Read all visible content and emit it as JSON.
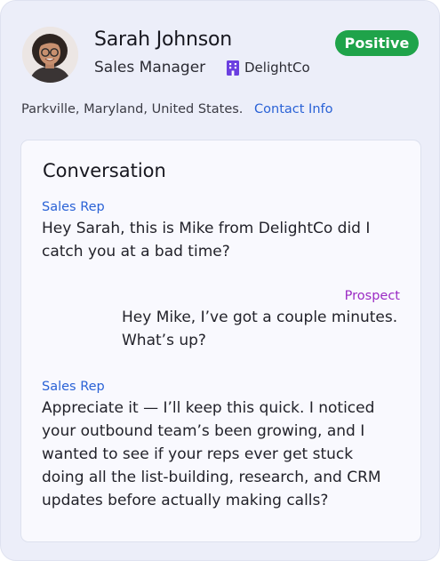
{
  "contact": {
    "name": "Sarah Johnson",
    "title": "Sales Manager",
    "company": "DelightCo",
    "company_icon": "building-icon",
    "sentiment": "Positive",
    "location": "Parkville, Maryland, United States.",
    "contact_link": "Contact Info"
  },
  "conversation": {
    "title": "Conversation",
    "messages": [
      {
        "speaker": "Sales Rep",
        "text": "Hey Sarah, this is Mike from DelightCo did I catch you at a bad time?"
      },
      {
        "speaker": "Prospect",
        "text": "Hey Mike, I’ve got a couple minutes. What’s up?"
      },
      {
        "speaker": "Sales Rep",
        "text": "Appreciate it — I’ll keep this quick. I noticed your outbound team’s been growing, and I wanted to see if your reps ever get stuck doing all the list-building, research, and CRM updates before actually making calls?"
      }
    ]
  },
  "colors": {
    "card_background": "#eceef9",
    "badge_positive": "#1fa34a",
    "sales_rep_label": "#2a62d6",
    "prospect_label": "#9b2bc4",
    "link": "#2a62d6",
    "company_icon": "#6b3fe0"
  }
}
